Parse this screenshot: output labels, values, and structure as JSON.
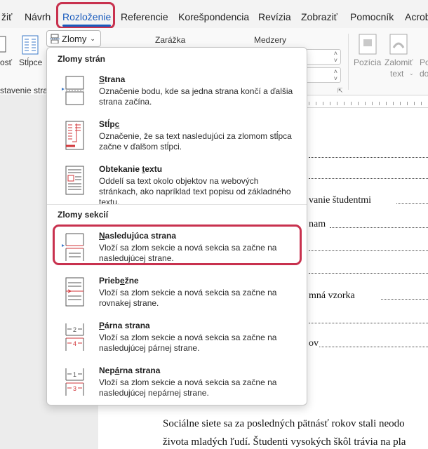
{
  "tabs": [
    {
      "label": "žiť",
      "active": false
    },
    {
      "label": "Návrh",
      "active": false
    },
    {
      "label": "Rozloženie",
      "active": true
    },
    {
      "label": "Referencie",
      "active": false
    },
    {
      "label": "Korešpondencia",
      "active": false
    },
    {
      "label": "Revízia",
      "active": false
    },
    {
      "label": "Zobraziť",
      "active": false
    },
    {
      "label": "Pomocník",
      "active": false
    },
    {
      "label": "Acrobat",
      "active": false
    }
  ],
  "ribbon": {
    "ost_label": "osť",
    "columns_label": "Stĺpce",
    "group_label": "stavenie strany",
    "breaks_button": "Zlomy",
    "indent_label": "Zarážka",
    "spacing_label": "Medzery",
    "position_label": "Pozícia",
    "wrap_label_1": "Zalomiť",
    "wrap_label_2": "text",
    "forward_label": "Po",
    "forward_label_2": "do"
  },
  "menu": {
    "page_breaks_header": "Zlomy strán",
    "section_breaks_header": "Zlomy sekcií",
    "items": [
      {
        "title_u": "S",
        "title_rest": "trana",
        "desc": "Označenie bodu, kde sa jedna strana končí a ďalšia strana začína."
      },
      {
        "title_pre": "Stĺp",
        "title_u": "c",
        "title_rest": "",
        "desc": "Označenie, že sa text nasledujúci za zlomom stĺpca začne v ďalšom stĺpci."
      },
      {
        "title_pre": "Obtekanie ",
        "title_u": "t",
        "title_rest": "extu",
        "desc": "Oddelí sa text okolo objektov na webových stránkach, ako napríklad text popisu od základného textu."
      },
      {
        "title_u": "N",
        "title_rest": "asledujúca strana",
        "desc": "Vloží sa zlom sekcie a nová sekcia sa začne na nasledujúcej strane."
      },
      {
        "title_pre": "Prieb",
        "title_u": "e",
        "title_rest": "žne",
        "desc": "Vloží sa zlom sekcie a nová sekcia sa začne na rovnakej strane."
      },
      {
        "title_u": "P",
        "title_rest": "árna strana",
        "desc": "Vloží sa zlom sekcie a nová sekcia sa začne na nasledujúcej párnej strane."
      },
      {
        "title_pre": "Nep",
        "title_u": "á",
        "title_rest": "rna strana",
        "desc": "Vloží sa zlom sekcie a nová sekcia sa začne na nasledujúcej nepárnej strane."
      }
    ]
  },
  "document": {
    "line1": "vanie študentmi",
    "line2": "nam",
    "line3": "mná vzorka",
    "line4": "ov",
    "para1": "Sociálne siete sa za posledných pätnásť rokov stali neodo",
    "para2": "života mladých ľudí. Študenti vysokých škôl trávia na pla"
  },
  "colors": {
    "accent": "#185abd",
    "highlight": "#c8314e",
    "icon_red": "#d13438"
  }
}
